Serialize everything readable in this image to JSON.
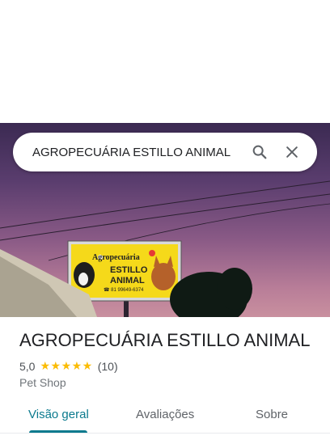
{
  "search": {
    "query": "AGROPECUÁRIA ESTILLO ANIMAL"
  },
  "photo": {
    "sign_line1": "Agropecuária",
    "sign_line2": "ESTILLO",
    "sign_line3": "ANIMAL",
    "sign_phone": "☎ 81 99649-6374"
  },
  "place": {
    "name": "AGROPECUÁRIA ESTILLO ANIMAL",
    "rating": "5,0",
    "stars": "★★★★★",
    "stars_value": 5,
    "review_count": "(10)",
    "category": "Pet Shop"
  },
  "tabs": [
    {
      "label": "Visão geral",
      "active": true
    },
    {
      "label": "Avaliações",
      "active": false
    },
    {
      "label": "Sobre",
      "active": false
    }
  ],
  "colors": {
    "accent": "#0b7a8e",
    "star": "#fbbc04",
    "sign_yellow": "#f5d91a"
  },
  "icons": {
    "search": "search-icon",
    "close": "close-icon"
  }
}
